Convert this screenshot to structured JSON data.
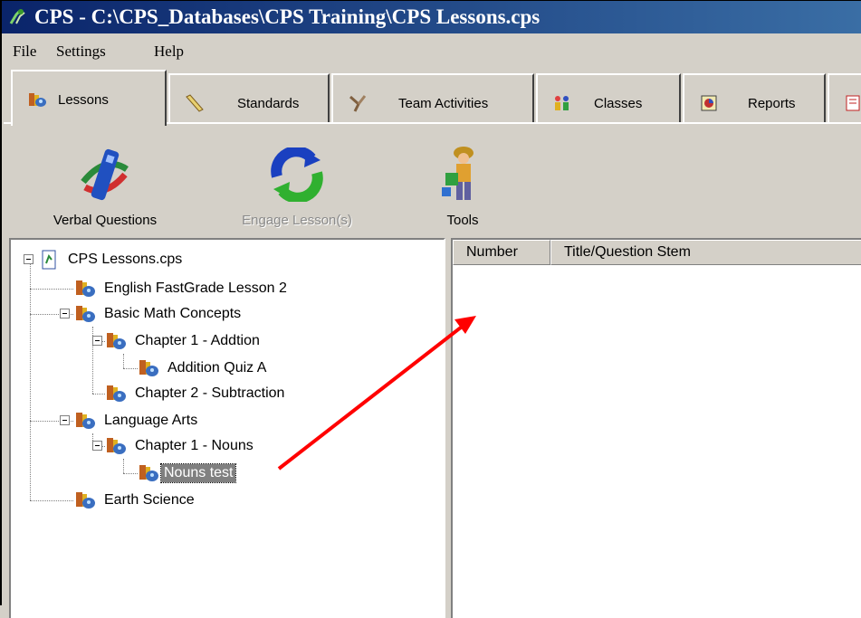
{
  "window": {
    "title": "CPS - C:\\CPS_Databases\\CPS Training\\CPS Lessons.cps"
  },
  "menu": [
    {
      "label": "File"
    },
    {
      "label": "Settings"
    },
    {
      "label": "Help"
    }
  ],
  "tabs": [
    {
      "label": "Lessons",
      "icon": "lessons-books-icon",
      "active": true
    },
    {
      "label": "Standards",
      "icon": "ruler-icon"
    },
    {
      "label": "Team Activities",
      "icon": "team-activities-icon"
    },
    {
      "label": "Classes",
      "icon": "classes-people-icon"
    },
    {
      "label": "Reports",
      "icon": "reports-icon"
    }
  ],
  "toolbar": [
    {
      "label": "Verbal Questions",
      "icon": "remote-control-icon",
      "enabled": true
    },
    {
      "label": "Engage Lesson(s)",
      "icon": "engage-arrows-icon",
      "enabled": false
    },
    {
      "label": "Tools",
      "icon": "tools-figure-icon",
      "enabled": true
    }
  ],
  "tree": {
    "root": "CPS Lessons.cps",
    "nodes": [
      {
        "label": "English FastGrade Lesson 2"
      },
      {
        "label": "Basic Math Concepts"
      },
      {
        "label": "Chapter 1 - Addtion"
      },
      {
        "label": "Addition Quiz A"
      },
      {
        "label": "Chapter 2 - Subtraction"
      },
      {
        "label": "Language Arts"
      },
      {
        "label": "Chapter 1 - Nouns"
      },
      {
        "label": "Nouns test",
        "selected": true
      },
      {
        "label": "Earth Science"
      }
    ]
  },
  "list": {
    "columns": [
      "Number",
      "Title/Question Stem"
    ]
  },
  "annotation": {
    "color": "#ff0000",
    "type": "arrow"
  },
  "colors": {
    "titlebar": "#0a246a",
    "face": "#d4d0c8",
    "selection": "#808080"
  }
}
